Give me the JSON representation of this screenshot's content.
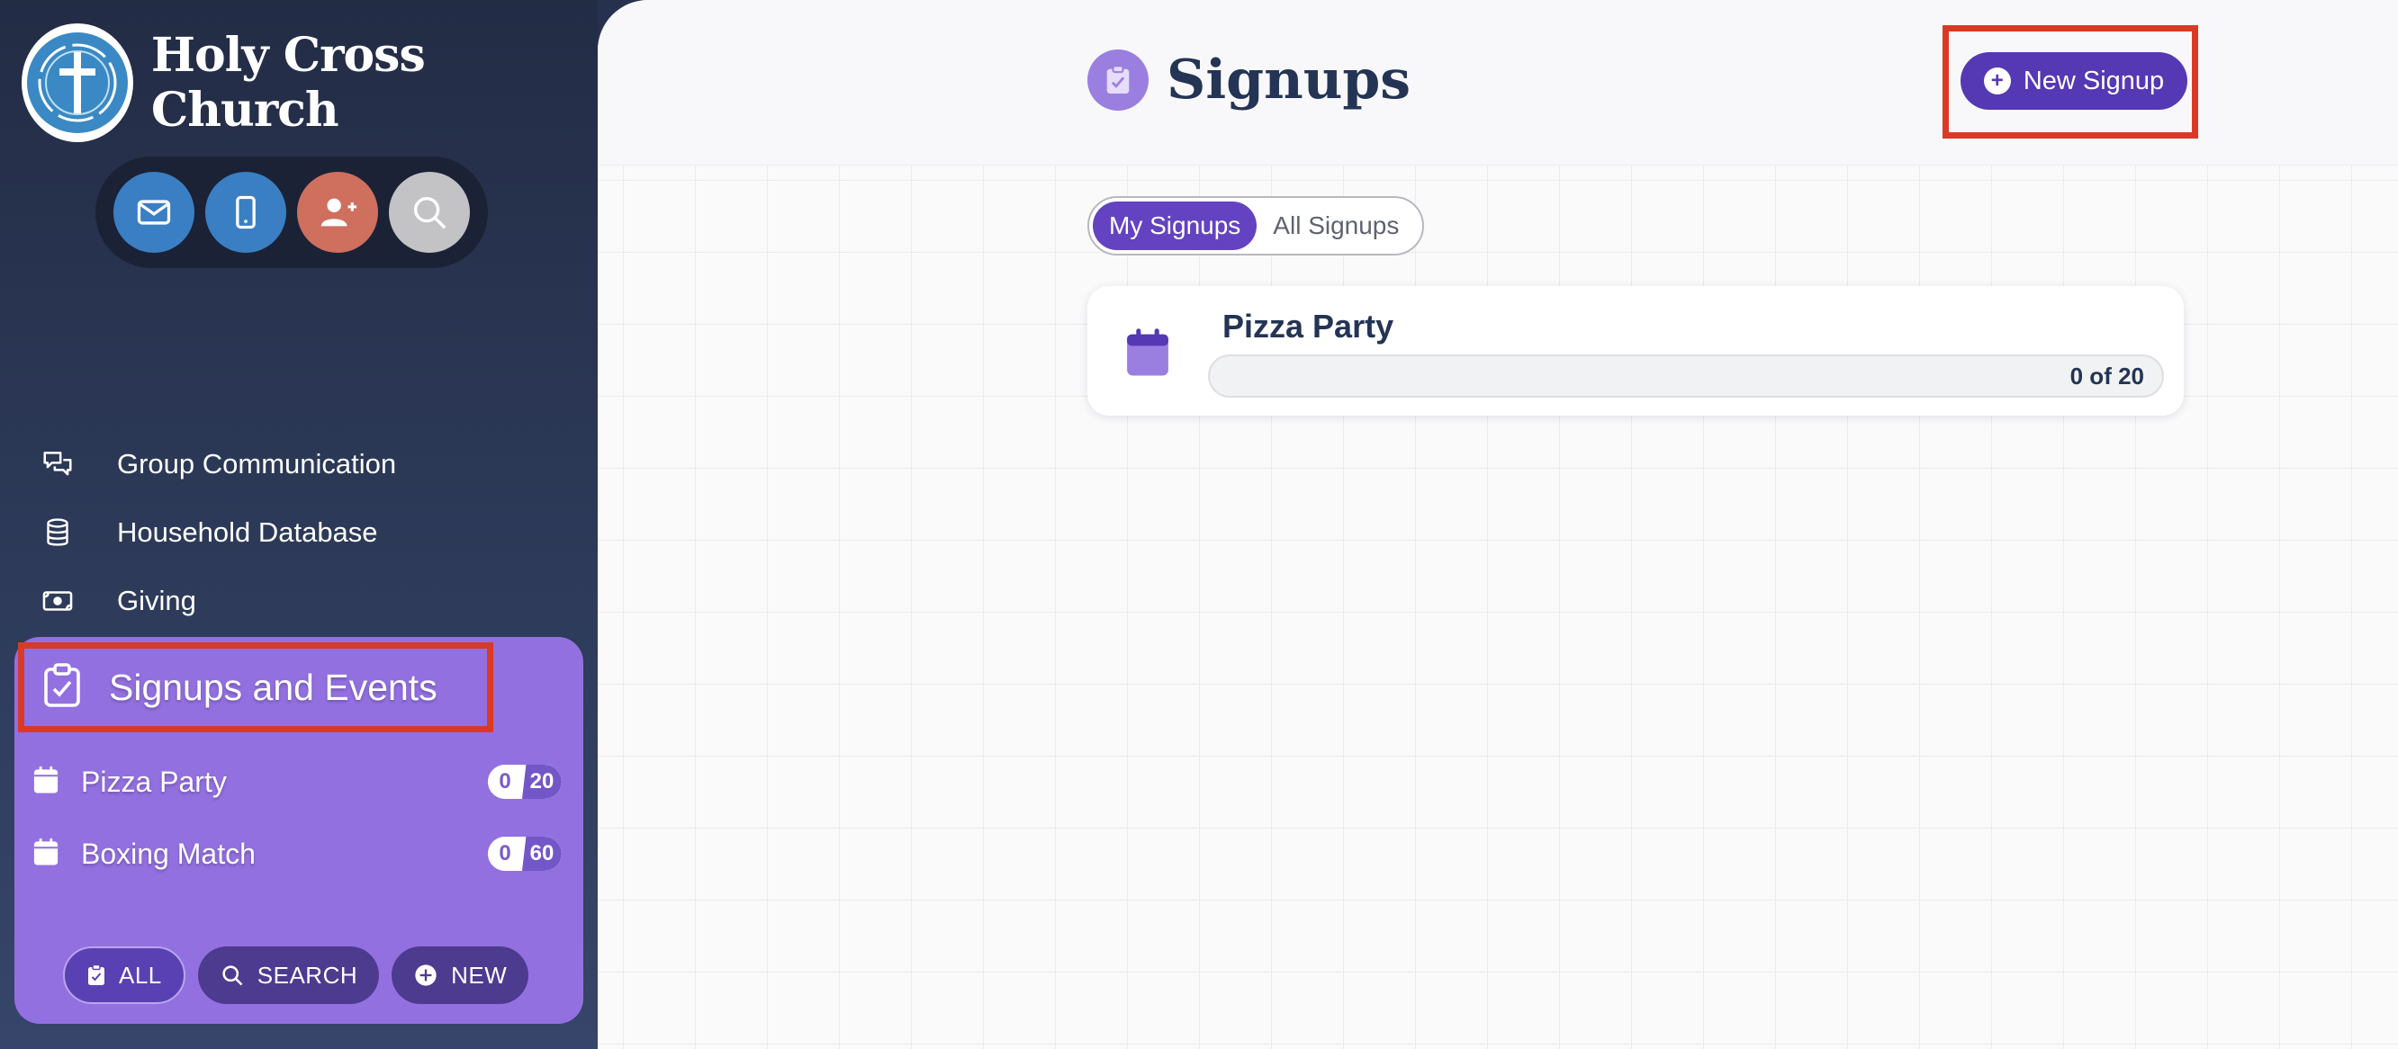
{
  "sidebar": {
    "brand_name": "Holy Cross Church",
    "quick_actions": [
      {
        "icon": "envelope-icon",
        "color": "#3a7fc3"
      },
      {
        "icon": "mobile-phone-icon",
        "color": "#3a7fc3"
      },
      {
        "icon": "add-person-icon",
        "color": "#cf6f5e"
      },
      {
        "icon": "search-icon",
        "color": "#c3c3c6"
      }
    ],
    "nav": [
      {
        "label": "Group Communication",
        "icon": "chat-bubbles-icon"
      },
      {
        "label": "Household Database",
        "icon": "database-icon"
      },
      {
        "label": "Giving",
        "icon": "money-icon"
      }
    ],
    "events_panel": {
      "title": "Signups and Events",
      "icon": "clipboard-check-icon",
      "color": "#9370e0",
      "events": [
        {
          "label": "Pizza Party",
          "filled": "0",
          "capacity": "20"
        },
        {
          "label": "Boxing Match",
          "filled": "0",
          "capacity": "60"
        }
      ],
      "actions": {
        "all": "ALL",
        "search": "SEARCH",
        "new": "NEW"
      }
    }
  },
  "main": {
    "page_title": "Signups",
    "new_signup_label": "New Signup",
    "tabs": [
      {
        "label": "My Signups",
        "active": true
      },
      {
        "label": "All Signups",
        "active": false
      }
    ],
    "cards": [
      {
        "title": "Pizza Party",
        "progress_text": "0 of 20",
        "filled": 0,
        "capacity": 20
      }
    ]
  },
  "colors": {
    "sidebar_bg": "#2b3856",
    "accent_purple": "#5538b3",
    "highlight_red": "#d93a25",
    "title_navy": "#243454"
  }
}
